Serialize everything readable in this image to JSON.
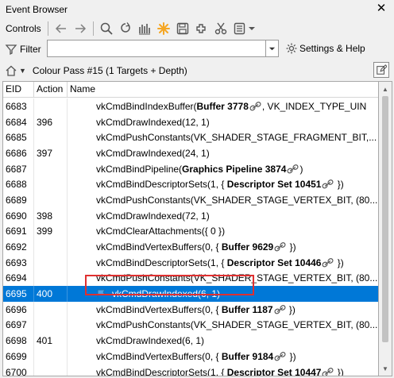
{
  "window": {
    "title": "Event Browser"
  },
  "toolbar": {
    "controls_label": "Controls"
  },
  "filter": {
    "label": "Filter",
    "value": "",
    "placeholder": "",
    "settings_label": "Settings & Help"
  },
  "breadcrumb": {
    "text": "Colour Pass #15 (1 Targets + Depth)"
  },
  "table": {
    "columns": {
      "eid": "EID",
      "action": "Action",
      "name": "Name"
    },
    "rows": [
      {
        "eid": "6683",
        "action": "",
        "segments": [
          [
            "vkCmdBindIndexBuffer(",
            ""
          ],
          [
            "Buffer 3778",
            "b"
          ],
          [
            "",
            "link"
          ],
          [
            ", VK_INDEX_TYPE_UIN",
            ""
          ]
        ]
      },
      {
        "eid": "6684",
        "action": "396",
        "segments": [
          [
            "vkCmdDrawIndexed(12, 1)",
            ""
          ]
        ]
      },
      {
        "eid": "6685",
        "action": "",
        "segments": [
          [
            "vkCmdPushConstants(VK_SHADER_STAGE_FRAGMENT_BIT,...",
            ""
          ]
        ]
      },
      {
        "eid": "6686",
        "action": "397",
        "segments": [
          [
            "vkCmdDrawIndexed(24, 1)",
            ""
          ]
        ]
      },
      {
        "eid": "6687",
        "action": "",
        "segments": [
          [
            "vkCmdBindPipeline(",
            ""
          ],
          [
            "Graphics Pipeline 3874",
            "b"
          ],
          [
            "",
            "link"
          ],
          [
            ")",
            ""
          ]
        ]
      },
      {
        "eid": "6688",
        "action": "",
        "segments": [
          [
            "vkCmdBindDescriptorSets(1, { ",
            ""
          ],
          [
            "Descriptor Set 10451",
            "b"
          ],
          [
            "",
            "link"
          ],
          [
            " })",
            ""
          ]
        ]
      },
      {
        "eid": "6689",
        "action": "",
        "segments": [
          [
            "vkCmdPushConstants(VK_SHADER_STAGE_VERTEX_BIT, (80...",
            ""
          ]
        ]
      },
      {
        "eid": "6690",
        "action": "398",
        "segments": [
          [
            "vkCmdDrawIndexed(72, 1)",
            ""
          ]
        ]
      },
      {
        "eid": "6691",
        "action": "399",
        "segments": [
          [
            "vkCmdClearAttachments({ 0 })",
            ""
          ]
        ]
      },
      {
        "eid": "6692",
        "action": "",
        "segments": [
          [
            "vkCmdBindVertexBuffers(0, { ",
            ""
          ],
          [
            "Buffer 9629",
            "b"
          ],
          [
            "",
            "link"
          ],
          [
            " })",
            ""
          ]
        ]
      },
      {
        "eid": "6693",
        "action": "",
        "segments": [
          [
            "vkCmdBindDescriptorSets(1, { ",
            ""
          ],
          [
            "Descriptor Set 10446",
            "b"
          ],
          [
            "",
            "link"
          ],
          [
            " })",
            ""
          ]
        ]
      },
      {
        "eid": "6694",
        "action": "",
        "segments": [
          [
            "vkCmdPushConstants(VK_SHADER_STAGE_VERTEX_BIT, (80...",
            ""
          ]
        ]
      },
      {
        "eid": "6695",
        "action": "400",
        "selected": true,
        "bookmark": true,
        "segments": [
          [
            "vkCmdDrawIndexed(6, 1)",
            ""
          ]
        ]
      },
      {
        "eid": "6696",
        "action": "",
        "segments": [
          [
            "vkCmdBindVertexBuffers(0, { ",
            ""
          ],
          [
            "Buffer 1187",
            "b"
          ],
          [
            "",
            "link"
          ],
          [
            " })",
            ""
          ]
        ]
      },
      {
        "eid": "6697",
        "action": "",
        "segments": [
          [
            "vkCmdPushConstants(VK_SHADER_STAGE_VERTEX_BIT, (80...",
            ""
          ]
        ]
      },
      {
        "eid": "6698",
        "action": "401",
        "segments": [
          [
            "vkCmdDrawIndexed(6, 1)",
            ""
          ]
        ]
      },
      {
        "eid": "6699",
        "action": "",
        "segments": [
          [
            "vkCmdBindVertexBuffers(0, { ",
            ""
          ],
          [
            "Buffer 9184",
            "b"
          ],
          [
            "",
            "link"
          ],
          [
            " })",
            ""
          ]
        ]
      },
      {
        "eid": "6700",
        "action": "",
        "segments": [
          [
            "vkCmdBindDescriptorSets(1, { ",
            ""
          ],
          [
            "Descriptor Set 10447",
            "b"
          ],
          [
            "",
            "link"
          ],
          [
            " })",
            ""
          ]
        ]
      }
    ]
  },
  "colors": {
    "selection": "#0078d7",
    "highlight_box": "#e03030",
    "accent_orange": "#f5a623"
  },
  "icons": [
    "close-icon",
    "back-arrow-icon",
    "forward-arrow-icon",
    "find-icon",
    "goto-icon",
    "timeline-icon",
    "bookmark-star-icon",
    "save-icon",
    "export-icon",
    "cut-icon",
    "menu-dropdown-icon",
    "filter-icon",
    "settings-icon",
    "home-icon",
    "edit-icon",
    "link-icon",
    "bookmark-flag-icon"
  ]
}
